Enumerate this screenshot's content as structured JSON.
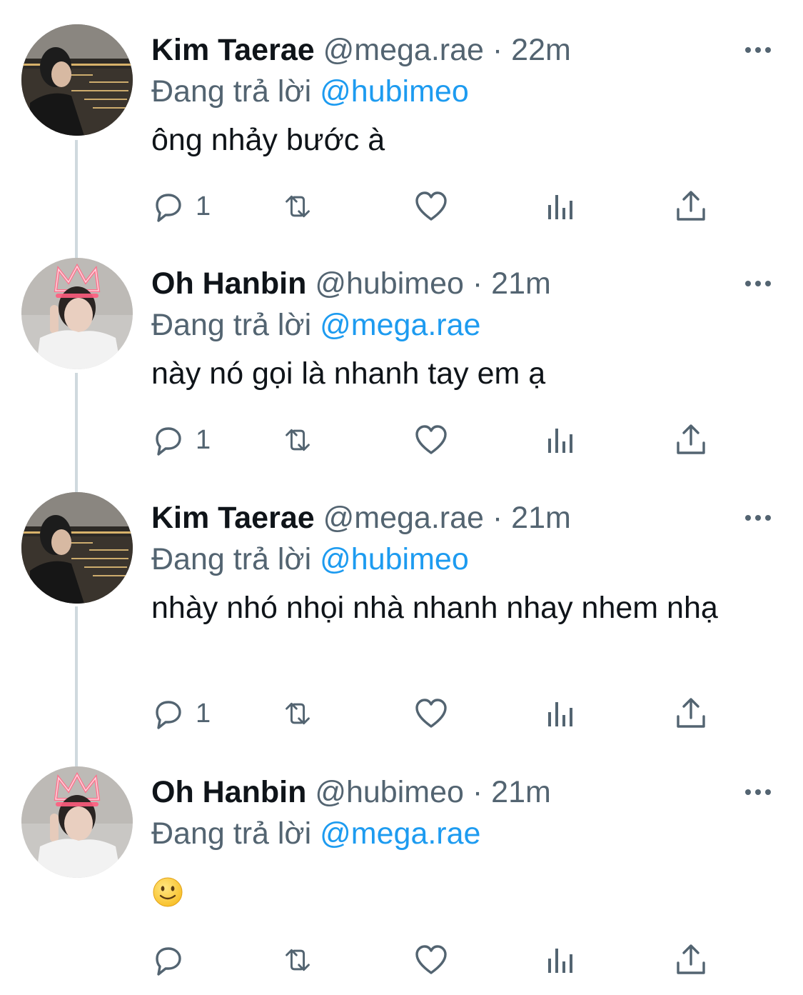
{
  "colors": {
    "name": "#0f1419",
    "secondary": "#536471",
    "mention": "#1d9bf0",
    "thread_line": "#cfd9de"
  },
  "thread": [
    {
      "name": "Kim Taerae",
      "handle": "@mega.rae",
      "separator": "·",
      "time": "22m",
      "reply_prefix": "Đang trả lời",
      "reply_to": "@hubimeo",
      "text": "ông nhảy bước à",
      "avatar": "night-river-city-photo",
      "replies": "1"
    },
    {
      "name": "Oh Hanbin",
      "handle": "@hubimeo",
      "separator": "·",
      "time": "21m",
      "reply_prefix": "Đang trả lời",
      "reply_to": "@mega.rae",
      "text": "này nó gọi là nhanh tay em ạ",
      "avatar": "neon-crown-portrait",
      "replies": "1"
    },
    {
      "name": "Kim Taerae",
      "handle": "@mega.rae",
      "separator": "·",
      "time": "21m",
      "reply_prefix": "Đang trả lời",
      "reply_to": "@hubimeo",
      "text": "nhày nhó nhọi nhà nhanh nhay nhem nhạ",
      "avatar": "night-river-city-photo",
      "replies": "1"
    },
    {
      "name": "Oh Hanbin",
      "handle": "@hubimeo",
      "separator": "·",
      "time": "21m",
      "reply_prefix": "Đang trả lời",
      "reply_to": "@mega.rae",
      "text": "",
      "emoji": "slightly-smiling-face",
      "avatar": "neon-crown-portrait",
      "replies": ""
    }
  ],
  "icons": {
    "reply": "reply-bubble-icon",
    "retweet": "retweet-icon",
    "like": "heart-icon",
    "views": "views-bar-icon",
    "share": "share-icon",
    "more": "more-dots-icon"
  }
}
